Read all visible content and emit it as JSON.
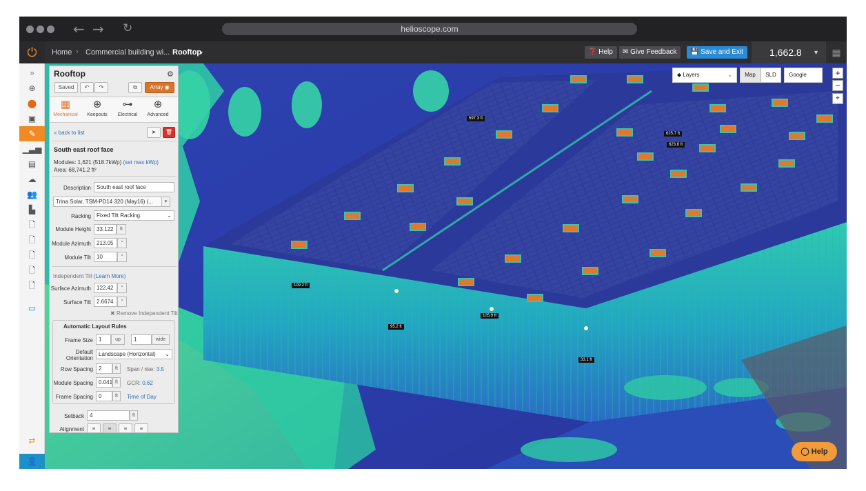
{
  "browser": {
    "url": "helioscope.com"
  },
  "topbar": {
    "breadcrumb": [
      "Home",
      "Commercial building wi...",
      "Rooftop"
    ],
    "help_label": "Help",
    "feedback_label": "Give Feedback",
    "save_exit_label": "Save and Exit",
    "kwp_value": "1,662.8"
  },
  "map": {
    "layers_label": "Layers",
    "tabs": [
      "Map",
      "SLD",
      "Google"
    ],
    "zoom_in": "+",
    "zoom_out": "−",
    "help_bubble": "Help",
    "labels": [
      "109.2 ft",
      "95.2 ft",
      "105.9 ft",
      "33.1 ft",
      "597.3 ft",
      "625.7 ft",
      "623.8 ft"
    ]
  },
  "panel": {
    "title": "Rooftop",
    "saved_label": "Saved",
    "array_label": "Array",
    "tabs": [
      {
        "label": "Mechanical",
        "icon": "grid-icon"
      },
      {
        "label": "Keepouts",
        "icon": "crosshair-icon"
      },
      {
        "label": "Electrical",
        "icon": "tree-icon"
      },
      {
        "label": "Advanced",
        "icon": "plus-circle-icon"
      }
    ],
    "back_link": "« back to list",
    "section_title": "South east roof face",
    "modules_text": "Modules: 1,621 (518.7kWp)",
    "set_max_link": "(set max kWp)",
    "area_text": "Area: 68,741.2 ft²",
    "description_label": "Description",
    "description_value": "South east roof face",
    "module_select": "Trina Solar, TSM-PD14 320 (May16) (...",
    "racking_label": "Racking",
    "racking_value": "Fixed Tilt Racking",
    "module_height_label": "Module Height",
    "module_height_value": "33.122",
    "module_height_unit": "ft",
    "module_azimuth_label": "Module Azimuth",
    "module_azimuth_value": "213.05",
    "module_tilt_label": "Module Tilt",
    "module_tilt_value": "10",
    "degree": "°",
    "independent_tilt_label": "Independent Tilt",
    "learn_more": "(Learn More)",
    "surface_azimuth_label": "Surface Azimuth",
    "surface_azimuth_value": "122.42",
    "surface_tilt_label": "Surface Tilt",
    "surface_tilt_value": "2.6674",
    "remove_independent_tilt": "✖ Remove Independent Tilt",
    "auto_layout_title": "Automatic Layout Rules",
    "frame_size_label": "Frame Size",
    "frame_size_up": "1",
    "up_label": "up",
    "frame_size_wide": "1",
    "wide_label": "wide",
    "orientation_label": "Default Orientation",
    "orientation_value": "Landscape (Horizontal)",
    "row_spacing_label": "Row Spacing",
    "row_spacing_value": "2",
    "span_rise_label": "Span / rise:",
    "span_rise_value": "3.5",
    "module_spacing_label": "Module Spacing",
    "module_spacing_value": "0.041",
    "gcr_label": "GCR:",
    "gcr_value": "0.62",
    "frame_spacing_label": "Frame Spacing",
    "frame_spacing_value": "0",
    "time_of_day": "Time of Day",
    "setback_label": "Setback",
    "setback_value": "4",
    "alignment_label": "Alignment",
    "ft": "ft"
  }
}
